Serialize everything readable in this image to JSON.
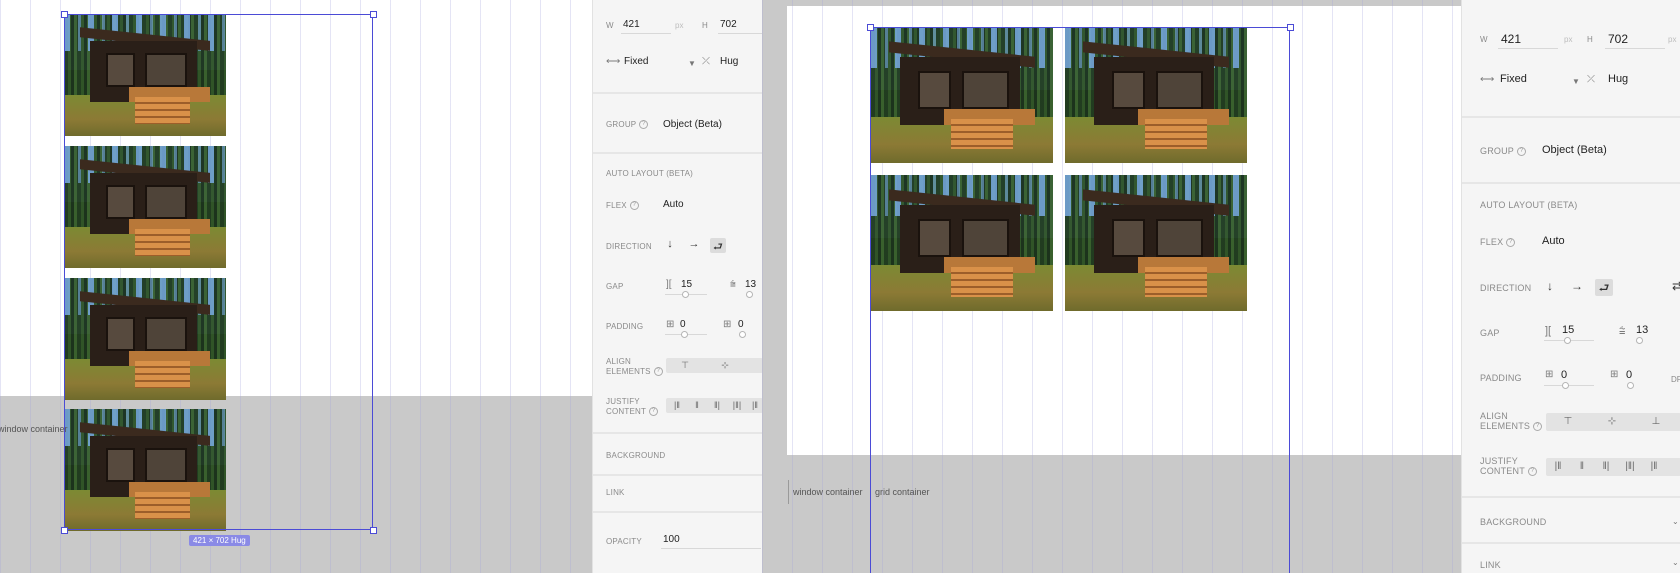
{
  "left_view": {
    "selection_badge": "421 × 702 Hug",
    "container_label": "window container",
    "photo_count": 4
  },
  "left_panel": {
    "width_label": "W",
    "width_value": "421",
    "width_unit": "px",
    "height_label": "H",
    "height_value": "702",
    "width_mode": "Fixed",
    "height_mode": "Hug",
    "group_label": "GROUP",
    "group_value": "Object (Beta)",
    "auto_layout_title": "AUTO LAYOUT (BETA)",
    "flex_label": "FLEX",
    "flex_value": "Auto",
    "direction_label": "DIRECTION",
    "direction_options": [
      "↓",
      "→",
      "⮐"
    ],
    "gap_label": "GAP",
    "gap_x": "15",
    "gap_y": "13",
    "padding_label": "PADDING",
    "padding_x": "0",
    "padding_y": "0",
    "align_label_1": "ALIGN",
    "align_label_2": "ELEMENTS",
    "justify_label_1": "JUSTIFY",
    "justify_label_2": "CONTENT",
    "background_label": "BACKGROUND",
    "link_label": "LINK",
    "opacity_label": "OPACITY",
    "opacity_value": "100"
  },
  "right_view": {
    "window_container_label": "window container",
    "grid_container_label": "grid container",
    "photo_count": 4
  },
  "right_panel": {
    "width_label": "W",
    "width_value": "421",
    "width_unit": "px",
    "height_label": "H",
    "height_value": "702",
    "height_unit": "px",
    "width_mode": "Fixed",
    "height_mode": "Hug",
    "group_label": "GROUP",
    "group_value": "Object (Beta)",
    "auto_layout_title": "AUTO LAYOUT (BETA)",
    "flex_label": "FLEX",
    "flex_value": "Auto",
    "direction_label": "DIRECTION",
    "gap_label": "GAP",
    "gap_x": "15",
    "gap_y": "13",
    "padding_label": "PADDING",
    "padding_x": "0",
    "padding_y": "0",
    "padding_extra": "DF",
    "align_label_1": "ALIGN",
    "align_label_2": "ELEMENTS",
    "justify_label_1": "JUSTIFY",
    "justify_label_2": "CONTENT",
    "background_label": "BACKGROUND",
    "link_label": "LINK"
  },
  "colors": {
    "selection": "#4b4bd6",
    "badge": "#8a8ae6",
    "panel_bg": "#f5f5f5",
    "canvas_bg": "#c9c9c9"
  }
}
